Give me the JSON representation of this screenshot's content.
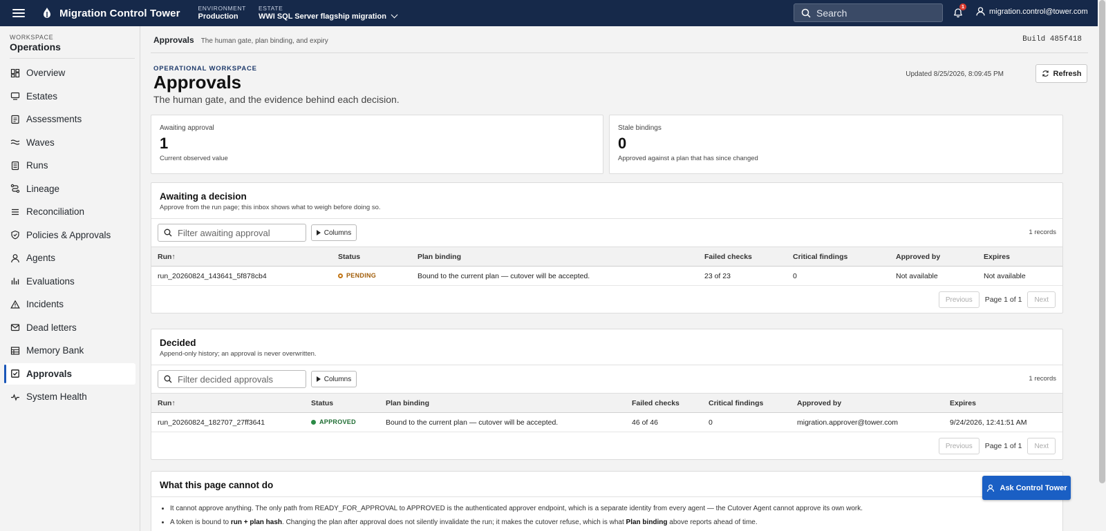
{
  "topbar": {
    "app_title": "Migration Control Tower",
    "environment_label": "ENVIRONMENT",
    "environment_value": "Production",
    "estate_label": "ESTATE",
    "estate_value": "WWI SQL Server flagship migration",
    "search_placeholder": "Search",
    "notification_count": "1",
    "user_email": "migration.control@tower.com"
  },
  "sidebar": {
    "workspace_label": "WORKSPACE",
    "workspace_name": "Operations",
    "items": [
      {
        "label": "Overview",
        "icon": "dashboard-icon"
      },
      {
        "label": "Estates",
        "icon": "server-icon"
      },
      {
        "label": "Assessments",
        "icon": "clipboard-icon"
      },
      {
        "label": "Waves",
        "icon": "waves-icon"
      },
      {
        "label": "Runs",
        "icon": "document-icon"
      },
      {
        "label": "Lineage",
        "icon": "route-icon"
      },
      {
        "label": "Reconciliation",
        "icon": "list-icon"
      },
      {
        "label": "Policies & Approvals",
        "icon": "shield-check-icon"
      },
      {
        "label": "Agents",
        "icon": "user-icon"
      },
      {
        "label": "Evaluations",
        "icon": "bar-chart-icon"
      },
      {
        "label": "Incidents",
        "icon": "warning-icon"
      },
      {
        "label": "Dead letters",
        "icon": "mail-icon"
      },
      {
        "label": "Memory Bank",
        "icon": "table-icon"
      },
      {
        "label": "Approvals",
        "icon": "check-square-icon",
        "active": true
      },
      {
        "label": "System Health",
        "icon": "pulse-icon"
      }
    ]
  },
  "header": {
    "crumb_title": "Approvals",
    "crumb_sub": "The human gate, plan binding, and expiry",
    "build": "Build 485f418",
    "eyebrow": "OPERATIONAL WORKSPACE",
    "title": "Approvals",
    "subtitle": "The human gate, and the evidence behind each decision.",
    "updated": "Updated 8/25/2026, 8:09:45 PM",
    "refresh_label": "Refresh"
  },
  "kpis": [
    {
      "label": "Awaiting approval",
      "value": "1",
      "sub": "Current observed value"
    },
    {
      "label": "Stale bindings",
      "value": "0",
      "sub": "Approved against a plan that has since changed"
    }
  ],
  "awaiting": {
    "title": "Awaiting a decision",
    "subtitle": "Approve from the run page; this inbox shows what to weigh before doing so.",
    "filter_placeholder": "Filter awaiting approval",
    "columns_label": "Columns",
    "records": "1 records",
    "headers": [
      "Run↑",
      "Status",
      "Plan binding",
      "Failed checks",
      "Critical findings",
      "Approved by",
      "Expires"
    ],
    "rows": [
      {
        "run": "run_20260824_143641_5f878cb4",
        "status": "PENDING",
        "plan_binding": "Bound to the current plan — cutover will be accepted.",
        "failed_checks": "23 of 23",
        "critical": "0",
        "approved_by": "Not available",
        "expires": "Not available"
      }
    ],
    "pager": {
      "previous": "Previous",
      "page": "Page 1 of 1",
      "next": "Next"
    }
  },
  "decided": {
    "title": "Decided",
    "subtitle": "Append-only history; an approval is never overwritten.",
    "filter_placeholder": "Filter decided approvals",
    "columns_label": "Columns",
    "records": "1 records",
    "headers": [
      "Run↑",
      "Status",
      "Plan binding",
      "Failed checks",
      "Critical findings",
      "Approved by",
      "Expires"
    ],
    "rows": [
      {
        "run": "run_20260824_182707_27ff3641",
        "status": "APPROVED",
        "plan_binding": "Bound to the current plan — cutover will be accepted.",
        "failed_checks": "46 of 46",
        "critical": "0",
        "approved_by": "migration.approver@tower.com",
        "expires": "9/24/2026, 12:41:51 AM"
      }
    ],
    "pager": {
      "previous": "Previous",
      "page": "Page 1 of 1",
      "next": "Next"
    }
  },
  "cannot": {
    "title": "What this page cannot do",
    "bullet1": "It cannot approve anything. The only path from READY_FOR_APPROVAL to APPROVED is the authenticated approver endpoint, which is a separate identity from every agent — the Cutover Agent cannot approve its own work.",
    "bullet2_a": "A token is bound to ",
    "bullet2_b": "run + plan hash",
    "bullet2_c": ". Changing the plan after approval does not silently invalidate the run; it makes the cutover refuse, which is what ",
    "bullet2_d": "Plan binding",
    "bullet2_e": " above reports ahead of time."
  },
  "assistant": {
    "label": "Ask Control Tower"
  },
  "colors": {
    "topbar": "#16294a",
    "accent": "#1a5fc4",
    "pending": "#c27411",
    "approved": "#2b8a46"
  }
}
